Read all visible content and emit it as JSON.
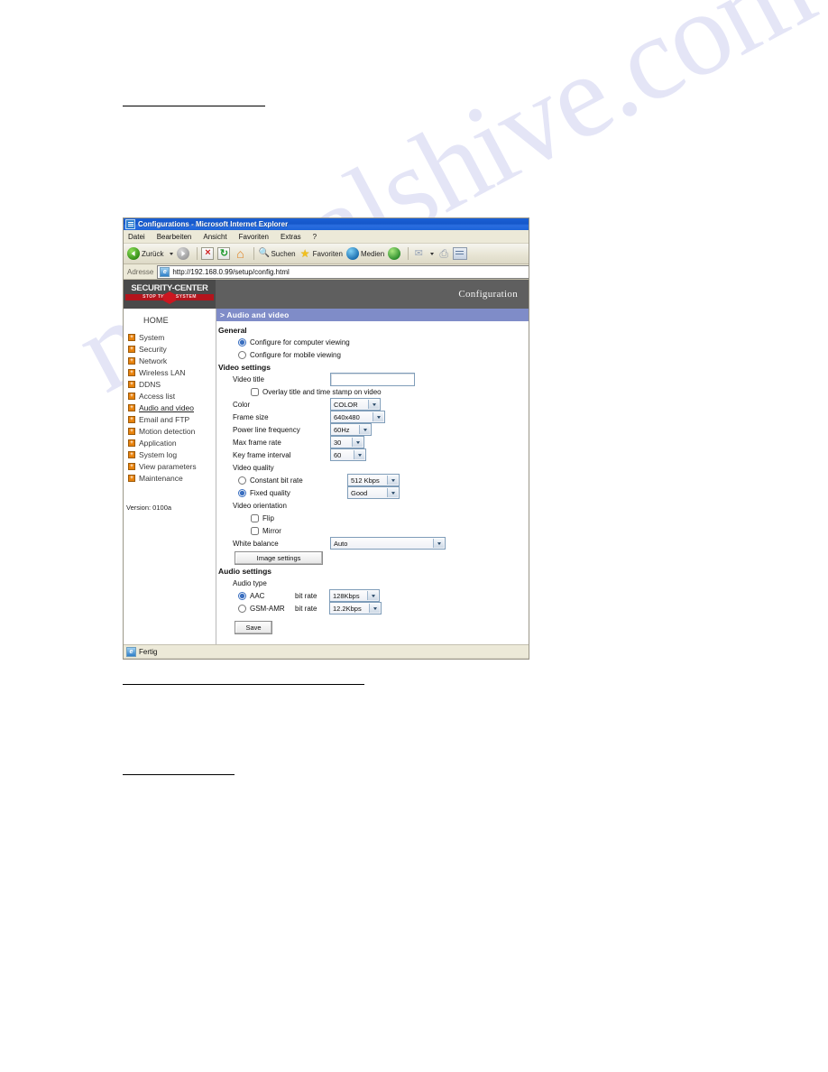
{
  "watermark": {
    "text": "manualshive.com"
  },
  "browser": {
    "title": "Configurations - Microsoft Internet Explorer",
    "menu": [
      "Datei",
      "Bearbeiten",
      "Ansicht",
      "Favoriten",
      "Extras",
      "?"
    ],
    "toolbar": {
      "back_label": "Zurück",
      "search_label": "Suchen",
      "favorites_label": "Favoriten",
      "media_label": "Medien"
    },
    "address": {
      "label": "Adresse",
      "url": "http://192.168.0.99/setup/config.html"
    },
    "status": {
      "text": "Fertig"
    }
  },
  "camera": {
    "logo": {
      "brand": "SECURITY-CENTER",
      "tagline": "STOP THEFT SYSTEM"
    },
    "header_title": "Configuration",
    "sidebar": {
      "home": "HOME",
      "items": [
        {
          "label": "System"
        },
        {
          "label": "Security"
        },
        {
          "label": "Network"
        },
        {
          "label": "Wireless LAN"
        },
        {
          "label": "DDNS"
        },
        {
          "label": "Access list"
        },
        {
          "label": "Audio and video"
        },
        {
          "label": "Email and FTP"
        },
        {
          "label": "Motion detection"
        },
        {
          "label": "Application"
        },
        {
          "label": "System log"
        },
        {
          "label": "View parameters"
        },
        {
          "label": "Maintenance"
        }
      ],
      "active_index": 6,
      "version": "Version: 0100a"
    },
    "section_bar": "> Audio and video",
    "general": {
      "title": "General",
      "option_computer": "Configure for computer viewing",
      "option_mobile": "Configure for mobile viewing",
      "selected": "computer"
    },
    "video_settings": {
      "title": "Video settings",
      "video_title_label": "Video title",
      "video_title_value": "",
      "overlay_label": "Overlay title and time stamp on video",
      "overlay_checked": false,
      "color_label": "Color",
      "color_value": "COLOR",
      "frame_size_label": "Frame size",
      "frame_size_value": "640x480",
      "power_line_label": "Power line frequency",
      "power_line_value": "60Hz",
      "max_frame_rate_label": "Max frame rate",
      "max_frame_rate_value": "30",
      "key_frame_label": "Key frame interval",
      "key_frame_value": "60",
      "video_quality_label": "Video quality",
      "cbr_label": "Constant bit rate",
      "cbr_value": "512 Kbps",
      "fixed_quality_label": "Fixed quality",
      "fixed_quality_value": "Good",
      "quality_selected": "fixed"
    },
    "video_orientation": {
      "title": "Video orientation",
      "flip_label": "Flip",
      "flip_checked": false,
      "mirror_label": "Mirror",
      "mirror_checked": false,
      "white_balance_label": "White balance",
      "white_balance_value": "Auto",
      "image_settings_button": "Image settings"
    },
    "audio_settings": {
      "title": "Audio settings",
      "audio_type_label": "Audio type",
      "aac_label": "AAC",
      "aac_bitrate_label": "bit rate",
      "aac_bitrate_value": "128Kbps",
      "gsm_label": "GSM-AMR",
      "gsm_bitrate_label": "bit rate",
      "gsm_bitrate_value": "12.2Kbps",
      "selected": "aac"
    },
    "save_button": "Save"
  }
}
